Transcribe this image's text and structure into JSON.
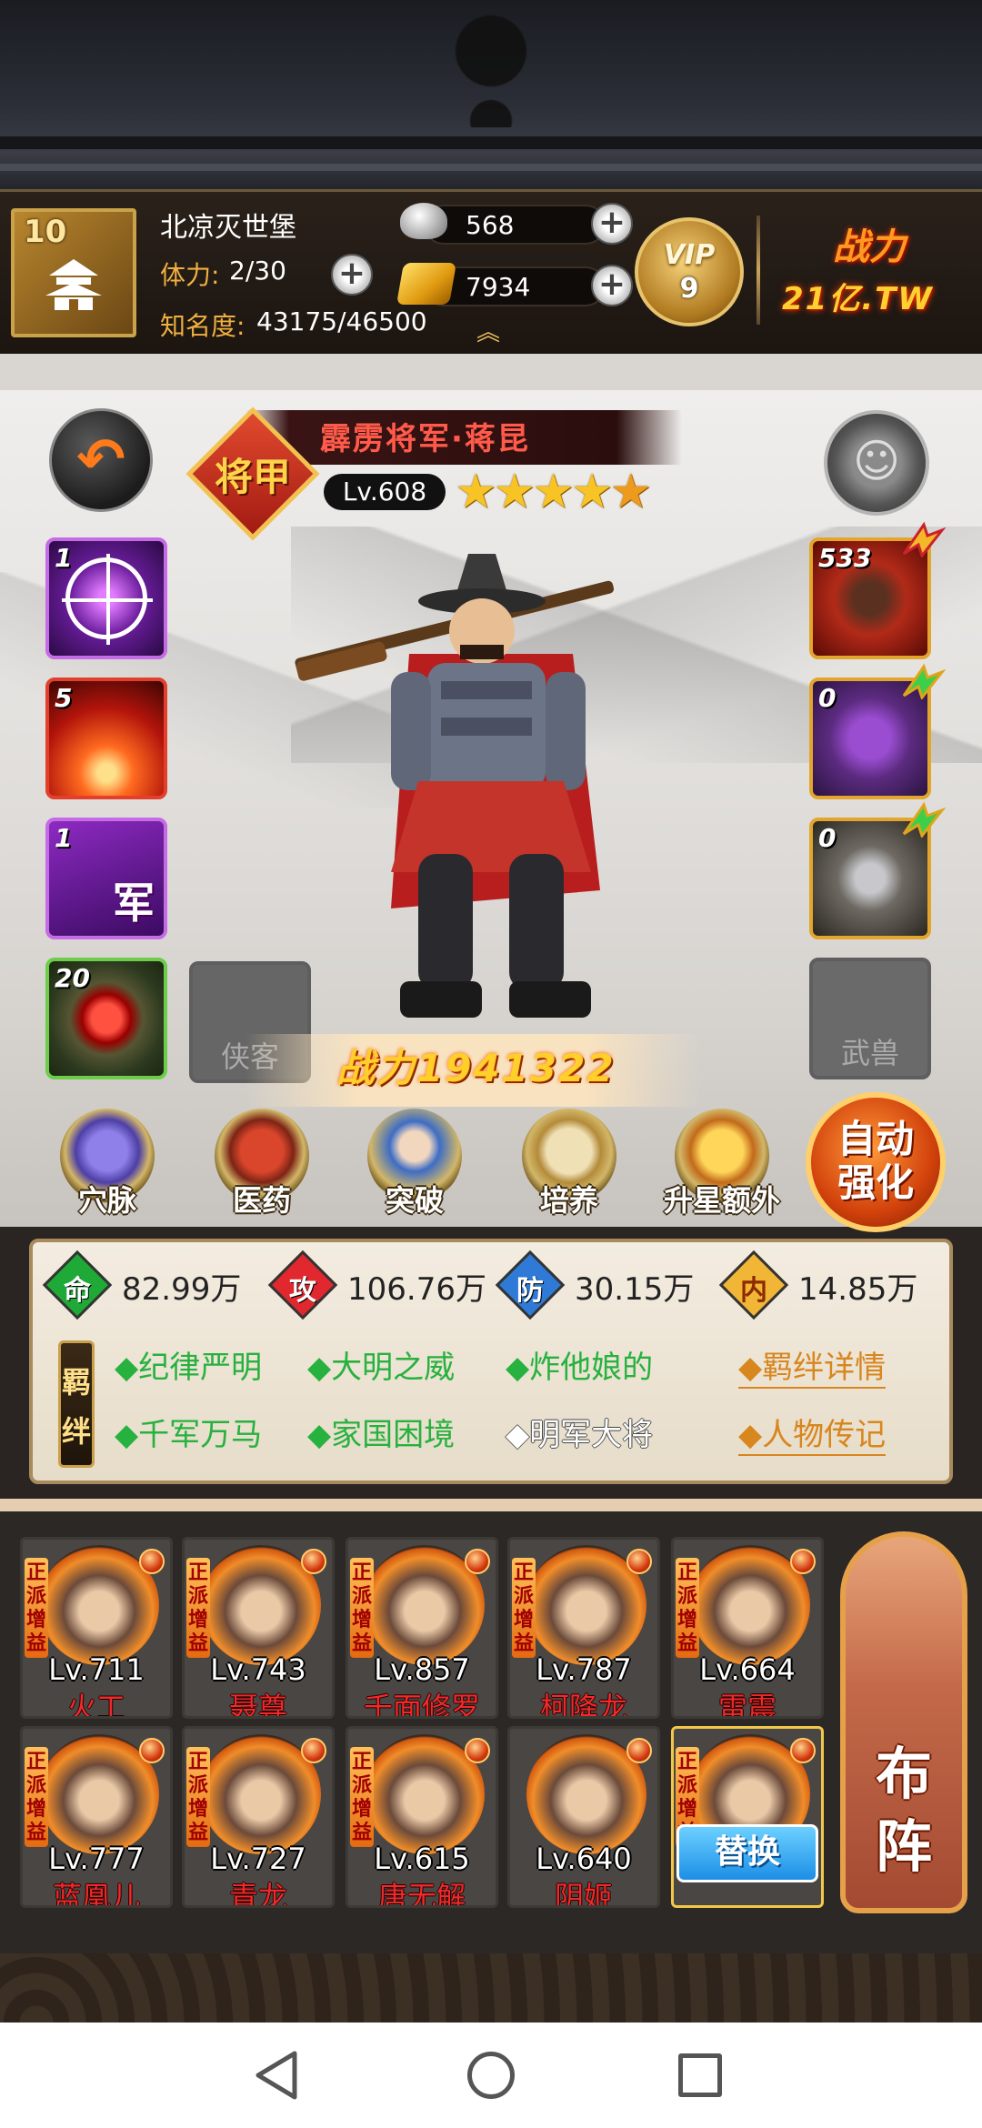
{
  "player": {
    "level": "10",
    "name": "北凉灭世堡",
    "stamina_label": "体力:",
    "stamina_value": "2/30",
    "fame_label": "知名度:",
    "fame_value": "43175/46500",
    "silver": "568",
    "gold": "7934",
    "vip_label": "VIP",
    "vip_level": "9",
    "power_label": "战力",
    "power_value": "21亿.TW"
  },
  "hero": {
    "name": "霹雳将军·蒋昆",
    "rank": "将甲",
    "level": "Lv.608",
    "stars": 5,
    "combat_power_label": "战力1941322"
  },
  "skills": [
    {
      "count": "1",
      "icon": "crosshair-skill-icon"
    },
    {
      "count": "5",
      "icon": "explosion-skill-icon"
    },
    {
      "count": "1",
      "icon": "army-skill-icon",
      "glyph": "军"
    },
    {
      "count": "20",
      "icon": "red-orb-skill-icon"
    }
  ],
  "slots": {
    "xiake": "侠客",
    "wushou": "武兽"
  },
  "equipment": [
    {
      "count": "533",
      "icon": "cannon-equip-icon"
    },
    {
      "count": "0",
      "icon": "armor-equip-icon"
    },
    {
      "count": "0",
      "icon": "beast-equip-icon"
    }
  ],
  "functions": [
    {
      "label": "穴脉",
      "icon": "acupoint-icon"
    },
    {
      "label": "医药",
      "icon": "medicine-icon"
    },
    {
      "label": "突破",
      "icon": "breakthrough-icon"
    },
    {
      "label": "培养",
      "icon": "train-icon"
    },
    {
      "label": "升星额外",
      "icon": "star-up-icon"
    }
  ],
  "auto_strengthen": {
    "line1": "自动",
    "line2": "强化"
  },
  "stats": [
    {
      "char": "命",
      "value": "82.99万",
      "color": "#1fa936"
    },
    {
      "char": "攻",
      "value": "106.76万",
      "color": "#e0282e"
    },
    {
      "char": "防",
      "value": "30.15万",
      "color": "#2e7ad6"
    },
    {
      "char": "内",
      "value": "14.85万",
      "color": "#f2b636"
    }
  ],
  "bonds": {
    "tag": "羁绊",
    "items": [
      {
        "text": "◆纪律严明",
        "active": true
      },
      {
        "text": "◆大明之威",
        "active": true
      },
      {
        "text": "◆炸他娘的",
        "active": true
      },
      {
        "text": "◆千军万马",
        "active": true
      },
      {
        "text": "◆家国困境",
        "active": true
      },
      {
        "text": "◆明军大将",
        "active": false
      }
    ],
    "detail_link": "◆羁绊详情",
    "bio_link": "◆人物传记"
  },
  "team": {
    "tag_text": "正派增益",
    "members": [
      {
        "level": "Lv.711",
        "name": "火工"
      },
      {
        "level": "Lv.743",
        "name": "聂尊"
      },
      {
        "level": "Lv.857",
        "name": "千面修罗"
      },
      {
        "level": "Lv.787",
        "name": "柯降龙"
      },
      {
        "level": "Lv.664",
        "name": "雷震"
      },
      {
        "level": "Lv.777",
        "name": "蓝凰儿"
      },
      {
        "level": "Lv.727",
        "name": "青龙"
      },
      {
        "level": "Lv.615",
        "name": "唐无解"
      },
      {
        "level": "Lv.640",
        "name": "阴姬"
      }
    ],
    "replace_label": "替换",
    "formation_line1": "布",
    "formation_line2": "阵"
  }
}
